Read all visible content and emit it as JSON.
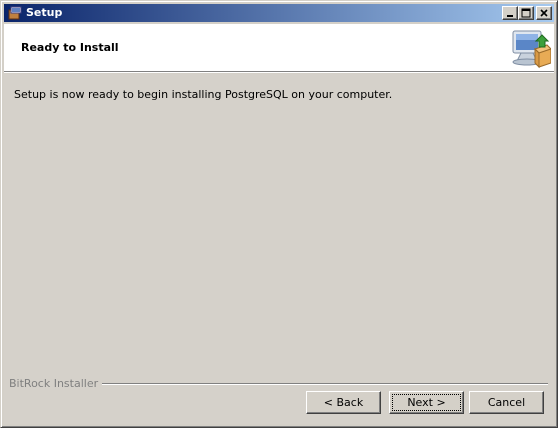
{
  "window": {
    "title": "Setup"
  },
  "header": {
    "title": "Ready to Install"
  },
  "main": {
    "message": "Setup is now ready to begin installing PostgreSQL on your computer."
  },
  "footer": {
    "brand": "BitRock Installer"
  },
  "buttons": {
    "back": "< Back",
    "next": "Next >",
    "cancel": "Cancel"
  },
  "icons": {
    "app": "installer-box-icon",
    "header_logo": "computer-package-icon"
  },
  "colors": {
    "titlebar_start": "#0a246a",
    "titlebar_end": "#a6caf0",
    "face": "#d4d0c8",
    "header_bg": "#ffffff",
    "footer_text": "#808080"
  }
}
